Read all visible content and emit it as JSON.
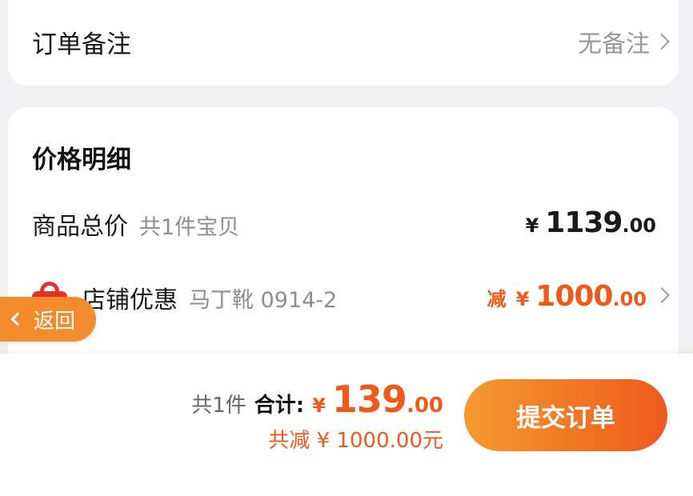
{
  "note": {
    "label": "订单备注",
    "value": "无备注"
  },
  "price_detail": {
    "title": "价格明细",
    "total_row": {
      "label": "商品总价",
      "sub": "共1件宝贝",
      "currency": "¥",
      "amount_int": "1139",
      "amount_dec": ".00"
    },
    "shop_row": {
      "label": "店铺优惠",
      "sub": "马丁靴 0914-2",
      "prefix": "减",
      "currency": "¥",
      "amount_int": "1000",
      "amount_dec": ".00"
    }
  },
  "back": {
    "label": "返回"
  },
  "bottom": {
    "count": "共1件",
    "total_label": "合计:",
    "currency": "¥",
    "amount_int": "139",
    "amount_dec": ".00",
    "discount": "共减 ¥ 1000.00元",
    "submit_label": "提交订单"
  },
  "colors": {
    "accent": "#ee5a1c",
    "accent_light": "#f49a2e",
    "shop_icon": "#e8302a"
  },
  "icons": {
    "note_chevron": "chevron-right-icon",
    "shop_chevron": "chevron-right-icon",
    "shop": "shopping-bag-icon",
    "back": "chevron-left-icon"
  }
}
